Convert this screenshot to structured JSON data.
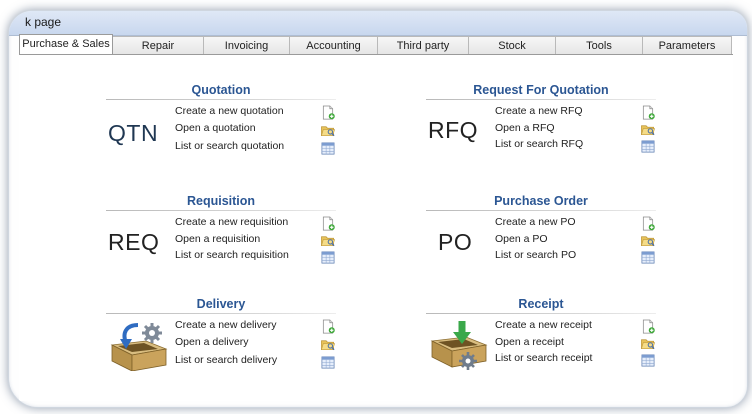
{
  "window": {
    "title": "k page"
  },
  "tabs": [
    "Purchase & Sales",
    "Repair",
    "Invoicing",
    "Accounting",
    "Third party",
    "Stock",
    "Tools",
    "Parameters"
  ],
  "sections": {
    "quotation": {
      "title": "Quotation",
      "abbr": "QTN",
      "links": [
        "Create a new quotation",
        "Open a quotation",
        "List or search quotation"
      ]
    },
    "rfq": {
      "title": "Request For Quotation",
      "abbr": "RFQ",
      "links": [
        "Create a new RFQ",
        "Open a RFQ",
        "List or search RFQ"
      ]
    },
    "requisition": {
      "title": "Requisition",
      "abbr": "REQ",
      "links": [
        "Create a new requisition",
        "Open a requisition",
        "List or search requisition"
      ]
    },
    "purchase_order": {
      "title": "Purchase Order",
      "abbr": "PO",
      "links": [
        "Create a new PO",
        "Open a PO",
        "List or search PO"
      ]
    },
    "delivery": {
      "title": "Delivery",
      "links": [
        "Create a new delivery",
        "Open a delivery",
        "List or search delivery"
      ]
    },
    "receipt": {
      "title": "Receipt",
      "links": [
        "Create a new receipt",
        "Open a receipt",
        "List or search receipt"
      ]
    }
  },
  "icons": {
    "create": "new-document-icon",
    "open": "open-folder-icon",
    "list": "list-table-icon",
    "delivery": "box-gear-icon",
    "receipt": "box-arrow-gear-icon"
  },
  "colors": {
    "section_title": "#2b5693",
    "tab_bar": "#c8d7ee"
  }
}
